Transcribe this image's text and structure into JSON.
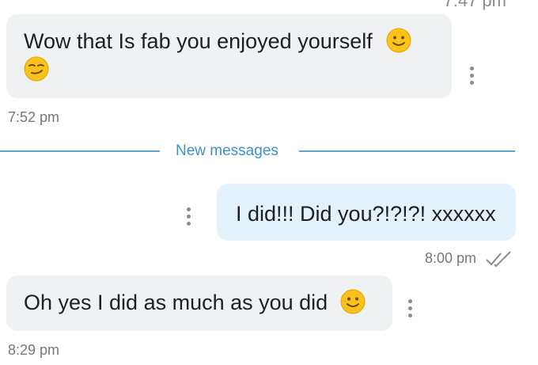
{
  "messages": [
    {
      "direction": "incoming",
      "text_line1": "Wow that Is fab you enjoyed yourself",
      "emojis": [
        "slightly-smiling-face",
        "smirking-face"
      ],
      "time": "7:52 pm"
    },
    {
      "direction": "outgoing",
      "text": "I did!!! Did you?!?!?! xxxxxx",
      "time": "8:00 pm",
      "status": "read"
    },
    {
      "direction": "incoming",
      "text": "Oh yes I did as much as you did",
      "emojis": [
        "slightly-smiling-face"
      ],
      "time": "8:29 pm"
    }
  ],
  "divider": {
    "label": "New messages"
  },
  "colors": {
    "incoming_bubble": "#f0f1f3",
    "outgoing_bubble": "#e3f1fb",
    "divider": "#5aa6d6",
    "emoji": "#fcc21b"
  }
}
